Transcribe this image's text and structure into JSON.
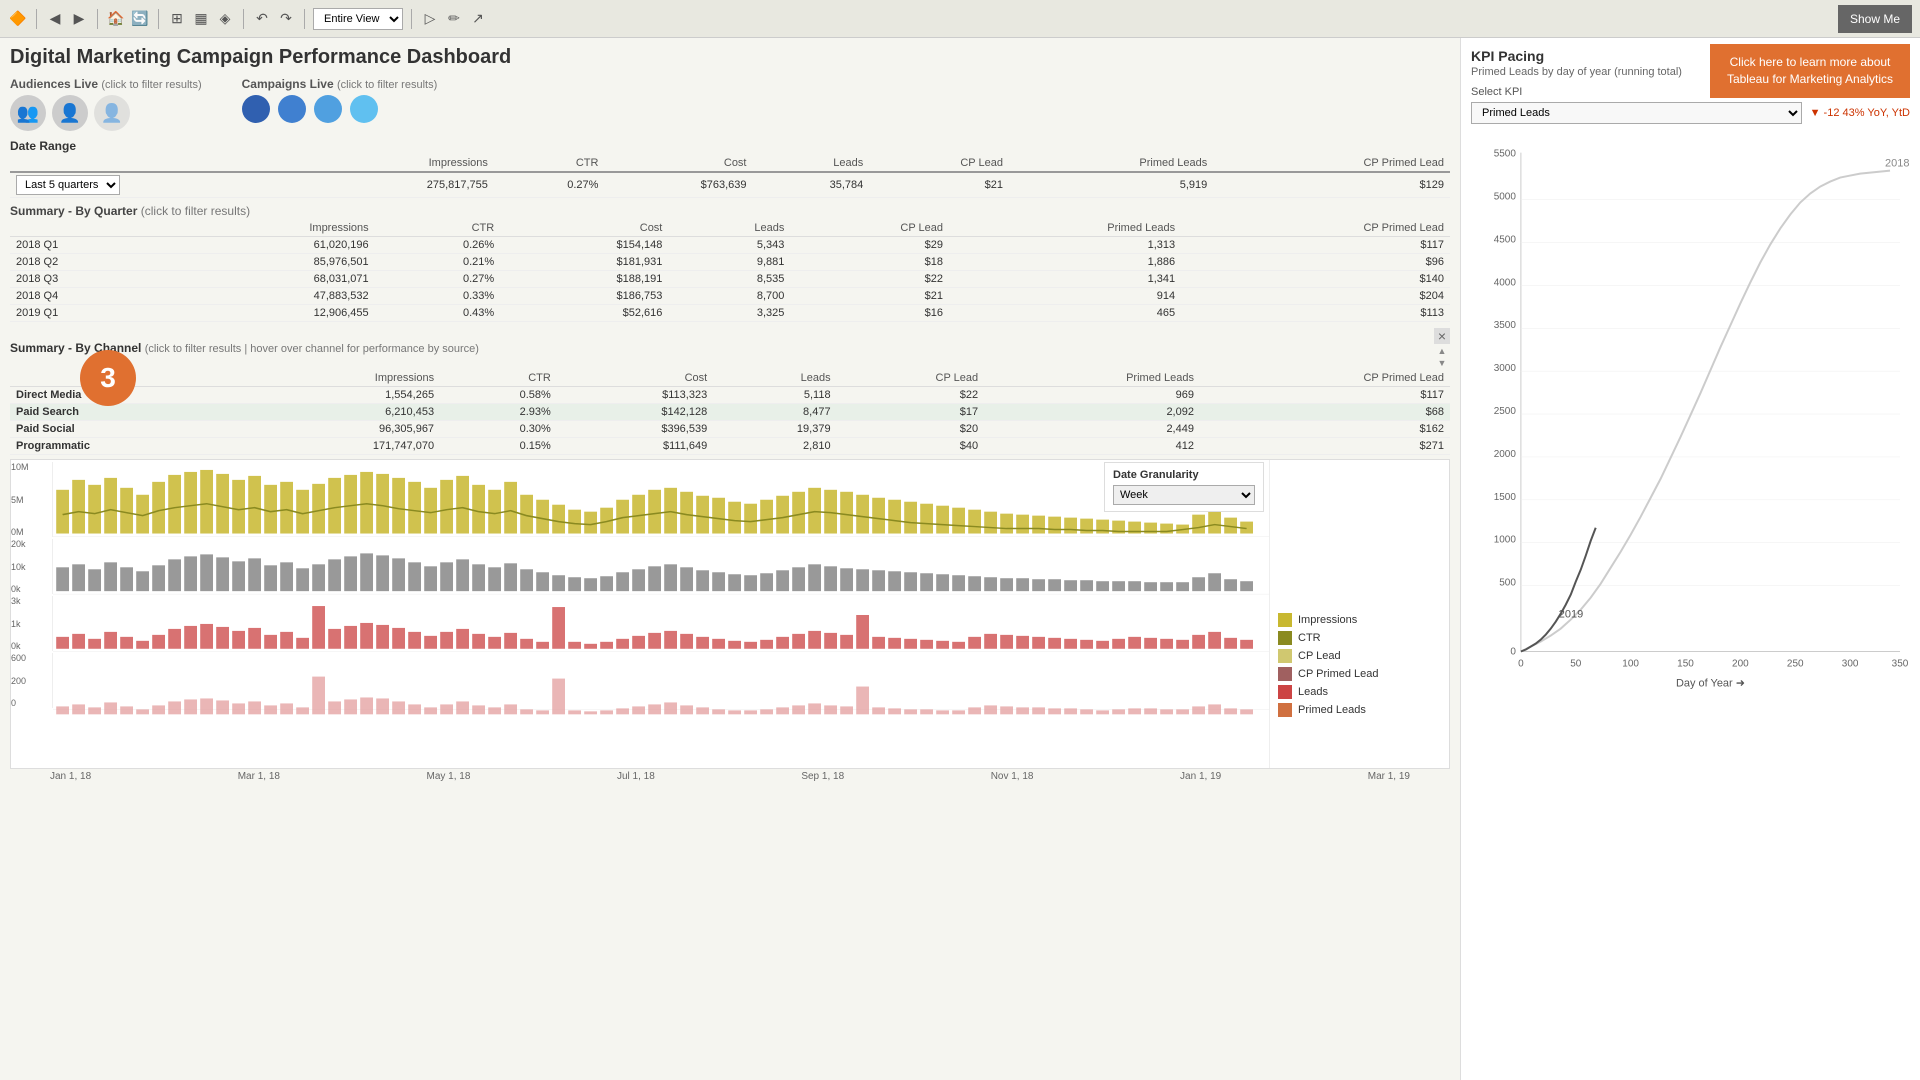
{
  "toolbar": {
    "view_dropdown": "Entire View",
    "show_me_label": "Show Me"
  },
  "cta": {
    "line1": "Click here to learn more about",
    "line2": "Tableau for Marketing Analytics"
  },
  "dashboard": {
    "title": "Digital Marketing Campaign Performance Dashboard",
    "audiences_label": "Audiences Live",
    "audiences_sub": "(click to filter results)",
    "campaigns_label": "Campaigns Live",
    "campaigns_sub": "(click to filter results)"
  },
  "date_range": {
    "label": "Date Range",
    "selected": "Last 5 quarters"
  },
  "summary_totals": {
    "impressions": "275,817,755",
    "ctr": "0.27%",
    "cost": "$763,639",
    "leads": "35,784",
    "cp_lead": "$21",
    "primed_leads": "5,919",
    "cp_primed_lead": "$129"
  },
  "columns": [
    "Impressions",
    "CTR",
    "Cost",
    "Leads",
    "CP Lead",
    "Primed Leads",
    "CP Primed Lead"
  ],
  "quarterly_data": [
    {
      "quarter": "2018 Q1",
      "impressions": "61,020,196",
      "ctr": "0.26%",
      "cost": "$154,148",
      "leads": "5,343",
      "cp_lead": "$29",
      "primed_leads": "1,313",
      "cp_primed_lead": "$117"
    },
    {
      "quarter": "2018 Q2",
      "impressions": "85,976,501",
      "ctr": "0.21%",
      "cost": "$181,931",
      "leads": "9,881",
      "cp_lead": "$18",
      "primed_leads": "1,886",
      "cp_primed_lead": "$96"
    },
    {
      "quarter": "2018 Q3",
      "impressions": "68,031,071",
      "ctr": "0.27%",
      "cost": "$188,191",
      "leads": "8,535",
      "cp_lead": "$22",
      "primed_leads": "1,341",
      "cp_primed_lead": "$140"
    },
    {
      "quarter": "2018 Q4",
      "impressions": "47,883,532",
      "ctr": "0.33%",
      "cost": "$186,753",
      "leads": "8,700",
      "cp_lead": "$21",
      "primed_leads": "914",
      "cp_primed_lead": "$204"
    },
    {
      "quarter": "2019 Q1",
      "impressions": "12,906,455",
      "ctr": "0.43%",
      "cost": "$52,616",
      "leads": "3,325",
      "cp_lead": "$16",
      "primed_leads": "465",
      "cp_primed_lead": "$113"
    }
  ],
  "channel_summary_label": "Summary - By Channel",
  "channel_summary_sub": "(click to filter results | hover over channel for performance by source)",
  "channel_data": [
    {
      "channel": "Direct Media",
      "impressions": "1,554,265",
      "ctr": "0.58%",
      "cost": "$113,323",
      "leads": "5,118",
      "cp_lead": "$22",
      "primed_leads": "969",
      "cp_primed_lead": "$117"
    },
    {
      "channel": "Paid Search",
      "impressions": "6,210,453",
      "ctr": "2.93%",
      "cost": "$142,128",
      "leads": "8,477",
      "cp_lead": "$17",
      "primed_leads": "2,092",
      "cp_primed_lead": "$68"
    },
    {
      "channel": "Paid Social",
      "impressions": "96,305,967",
      "ctr": "0.30%",
      "cost": "$396,539",
      "leads": "19,379",
      "cp_lead": "$20",
      "primed_leads": "2,449",
      "cp_primed_lead": "$162"
    },
    {
      "channel": "Programmatic",
      "impressions": "171,747,070",
      "ctr": "0.15%",
      "cost": "$111,649",
      "leads": "2,810",
      "cp_lead": "$40",
      "primed_leads": "412",
      "cp_primed_lead": "$271"
    }
  ],
  "step_badge": "3",
  "charts": {
    "x_labels": [
      "Jan 1, 18",
      "Mar 1, 18",
      "May 1, 18",
      "Jul 1, 18",
      "Sep 1, 18",
      "Nov 1, 18",
      "Jan 1, 19",
      "Mar 1, 19"
    ]
  },
  "granularity": {
    "label": "Date Granularity",
    "selected": "Week"
  },
  "legend_items": [
    {
      "label": "Impressions",
      "color": "#c8b830"
    },
    {
      "label": "CTR",
      "color": "#8a8a20"
    },
    {
      "label": "CP Lead",
      "color": "#d0c870"
    },
    {
      "label": "CP Primed Lead",
      "color": "#a06060"
    },
    {
      "label": "Leads",
      "color": "#cc4444"
    },
    {
      "label": "Primed Leads",
      "color": "#d07040"
    }
  ],
  "kpi": {
    "title": "KPI Pacing",
    "subtitle": "Primed Leads by day of year (running total)",
    "select_label": "Select KPI",
    "selected_kpi": "Primed Leads",
    "yoy_badge": "▼ -12 43% YoY, YtD",
    "year_2018": "2018",
    "year_2019": "2019",
    "y_labels": [
      "5500",
      "5000",
      "4500",
      "4000",
      "3500",
      "3000",
      "2500",
      "2000",
      "1500",
      "1000",
      "500",
      "0"
    ],
    "x_labels": [
      "0",
      "50",
      "100",
      "150",
      "200",
      "250",
      "300",
      "350"
    ],
    "x_axis_label": "Day of Year ➜"
  },
  "campaign_dot_colors": [
    "#3060b0",
    "#4080d0",
    "#50a0e0",
    "#60c0f0"
  ],
  "audience_icons": [
    "👥",
    "👤",
    "👤"
  ]
}
